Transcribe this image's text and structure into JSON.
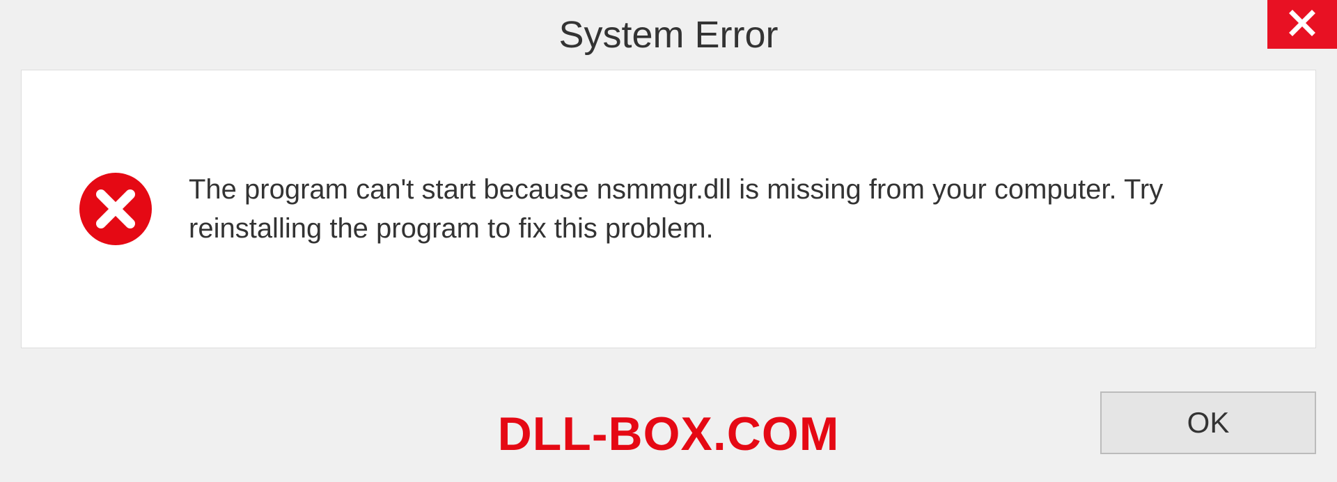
{
  "titlebar": {
    "title": "System Error"
  },
  "dialog": {
    "message": "The program can't start because nsmmgr.dll is missing from your computer. Try reinstalling the program to fix this problem."
  },
  "footer": {
    "watermark": "DLL-BOX.COM",
    "ok_label": "OK"
  },
  "colors": {
    "close_bg": "#e81123",
    "error_icon": "#e50914",
    "watermark": "#e50914"
  }
}
